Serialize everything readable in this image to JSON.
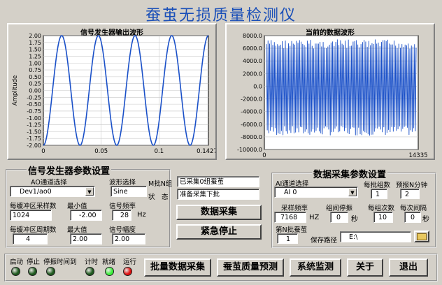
{
  "window": {
    "title": "蚕茧无损质量检测仪"
  },
  "graph1": {
    "title": "信号发生器输出波形",
    "ylabel": "Amplitude",
    "yticks": [
      "2.00",
      "1.75",
      "1.50",
      "1.25",
      "1.00",
      "0.75",
      "0.50",
      "0.25",
      "0.00",
      "-0.25",
      "-0.50",
      "-0.75",
      "-1.00",
      "-1.25",
      "-1.50",
      "-1.75",
      "-2.00"
    ],
    "xticks": [
      "0",
      "0.05",
      "0.1",
      "0.1427"
    ]
  },
  "graph2": {
    "title": "当前的数据波形",
    "yticks": [
      "8000.0",
      "6000.0",
      "4000.0",
      "2000.0",
      "0.0",
      "-2000.0",
      "-4000.0",
      "-6000.0",
      "-8000.0",
      "-10000.0"
    ],
    "xticks": [
      "0",
      "14335"
    ]
  },
  "chart_data": [
    {
      "type": "line",
      "title": "信号发生器输出波形",
      "ylabel": "Amplitude",
      "xlabel": "",
      "xlim": [
        0,
        0.1427
      ],
      "ylim": [
        -2,
        2
      ],
      "waveform": "sine",
      "amplitude": 2,
      "cycles": 4.5,
      "line_color": "#1a50c8"
    },
    {
      "type": "line",
      "title": "当前的数据波形",
      "xlim": [
        0,
        14335
      ],
      "ylim": [
        -10000,
        8000
      ],
      "amplitude_range": [
        -7800,
        7400
      ],
      "line_color": "#1a50c8"
    }
  ],
  "ao_panel": {
    "title": "信号发生器参数设置",
    "channel_label": "AO通道选择",
    "channel_value": "Dev1/ao0",
    "wave_label": "波形选择",
    "wave_value": "Sine",
    "samples_label": "每缓冲区采样数",
    "samples_value": "1024",
    "min_label": "最小值",
    "min_value": "-2.00",
    "freq_label": "信号频率",
    "freq_value": "28",
    "freq_unit": "Hz",
    "periods_label": "每缓冲区周期数",
    "periods_value": "4",
    "max_label": "最大值",
    "max_value": "2.00",
    "amp_label": "信号幅度",
    "amp_value": "2.00"
  },
  "middle": {
    "batch_label": "M批N组",
    "batch_value": "已采集0组蚕茧",
    "status_label": "状　态",
    "status_value": "准备采集下批",
    "acquire_btn": "数据采集",
    "stop_btn": "紧急停止"
  },
  "ai_panel": {
    "title": "数据采集参数设置",
    "channel_label": "AI通道选择",
    "channel_value": "AI 0",
    "groups_label": "每批组数",
    "groups_value": "1",
    "warn_label": "预报N分钟",
    "warn_value": "2",
    "rate_label": "采样频率",
    "rate_value": "7168",
    "rate_unit": "HZ",
    "pause_label": "组间停振",
    "pause_value": "0",
    "pause_unit": "秒",
    "count_label": "每组次数",
    "count_value": "10",
    "interval_label": "每次间隔",
    "interval_value": "0",
    "interval_unit": "秒",
    "batchn_label": "第N批蚕茧",
    "batchn_value": "1",
    "path_label": "保存路径",
    "path_value": "E:\\"
  },
  "status_bar": {
    "leds": [
      {
        "label": "启动",
        "color": "#1f5a1f"
      },
      {
        "label": "停止",
        "color": "#1f5a1f"
      },
      {
        "label": "停振时间到",
        "color": "#1f5a1f"
      },
      {
        "label": "计时",
        "color": "#1f5a1f"
      },
      {
        "label": "就绪",
        "color": "#3cf03c"
      },
      {
        "label": "运行",
        "color": "#e01010"
      }
    ],
    "buttons": [
      "批量数据采集",
      "蚕茧质量预测",
      "系统监测",
      "关于",
      "退出"
    ]
  }
}
